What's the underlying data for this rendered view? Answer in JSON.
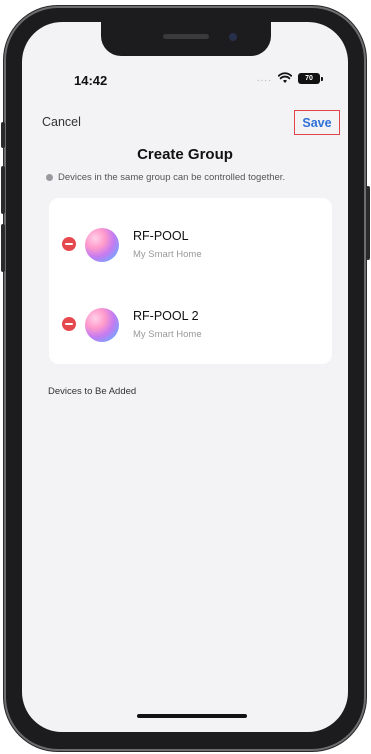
{
  "status_bar": {
    "time": "14:42",
    "signal_dots": "....",
    "battery": "70"
  },
  "nav": {
    "cancel_label": "Cancel",
    "save_label": "Save"
  },
  "page": {
    "title": "Create Group",
    "hint": "Devices in the same group can be controlled together."
  },
  "devices": [
    {
      "name": "RF-POOL",
      "home": "My Smart Home"
    },
    {
      "name": "RF-POOL 2",
      "home": "My Smart Home"
    }
  ],
  "to_be_added": {
    "label": "Devices to Be Added"
  },
  "colors": {
    "accent": "#2f6fd6",
    "remove": "#e5484d",
    "highlight_box": "#e0474c",
    "background": "#f3f3f6"
  }
}
